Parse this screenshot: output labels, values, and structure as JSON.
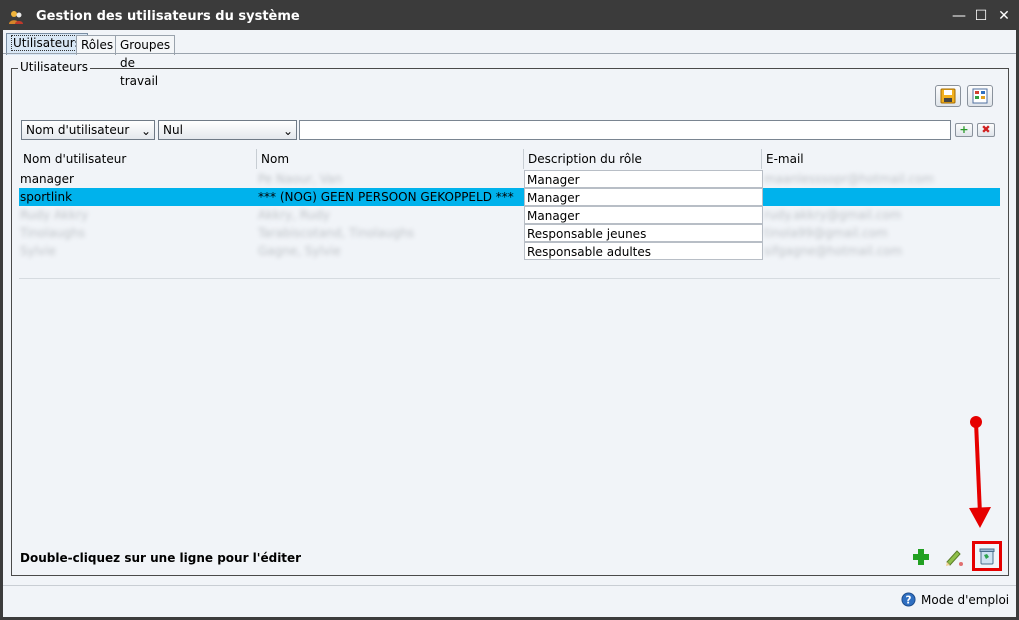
{
  "window": {
    "title": "Gestion des utilisateurs du système",
    "controls": {
      "minimize": "—",
      "maximize": "☐",
      "close": "✕"
    }
  },
  "tabs": [
    {
      "label": "Utilisateurs",
      "active": true
    },
    {
      "label": "Rôles",
      "active": false
    },
    {
      "label": "Groupes de travail",
      "active": false
    }
  ],
  "group": {
    "legend": "Utilisateurs"
  },
  "toolbar": {
    "save_icon": "save-icon",
    "export_icon": "export-icon"
  },
  "filter": {
    "field_select": "Nom d'utilisateur",
    "operator_select": "Nul",
    "value": "",
    "add_label": "+",
    "remove_label": "✖"
  },
  "table": {
    "columns": [
      "Nom d'utilisateur",
      "Nom",
      "Description du rôle",
      "E-mail"
    ],
    "rows": [
      {
        "username": "manager",
        "name": "Pe Naour, Van",
        "role": "Manager",
        "email": "maanlesssopr@hotmail.com",
        "selected": false,
        "username_blurred": false,
        "name_blurred": true,
        "email_blurred": true
      },
      {
        "username": "sportlink",
        "name": "*** (NOG) GEEN PERSOON GEKOPPELD ***",
        "role": "Manager",
        "email": "",
        "selected": true,
        "username_blurred": false,
        "name_blurred": false,
        "email_blurred": true
      },
      {
        "username": "Rudy Akkry",
        "name": "Akkry, Rudy",
        "role": "Manager",
        "email": "rudy.akkry@gmail.com",
        "selected": false,
        "username_blurred": true,
        "name_blurred": true,
        "email_blurred": true
      },
      {
        "username": "Tinolaughs",
        "name": "Tarabiscotand, Tinolaughs",
        "role": "Responsable jeunes",
        "email": "tinola99@gmail.com",
        "selected": false,
        "username_blurred": true,
        "name_blurred": true,
        "email_blurred": true
      },
      {
        "username": "Sylvie",
        "name": "Gagne, Sylvie",
        "role": "Responsable adultes",
        "email": "sifgagne@hotmail.com",
        "selected": false,
        "username_blurred": true,
        "name_blurred": true,
        "email_blurred": true
      }
    ]
  },
  "footer": {
    "hint": "Double-cliquez sur une ligne pour l'éditer",
    "add_icon": "add-icon",
    "edit_icon": "edit-icon",
    "delete_icon": "recycle-bin-icon",
    "help_label": "Mode d'emploi"
  },
  "colors": {
    "selected_row": "#00b2ec",
    "annotation": "#e60000",
    "titlebar": "#3b3b3b",
    "background": "#f1f4f8"
  }
}
